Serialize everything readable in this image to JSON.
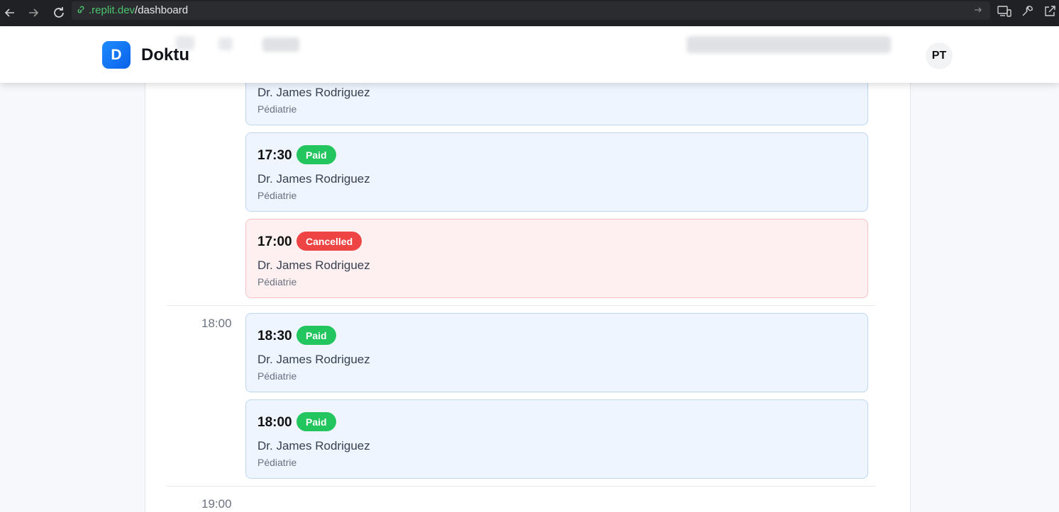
{
  "browser": {
    "url_host": ".replit.dev",
    "url_path": "/dashboard"
  },
  "header": {
    "logo_letter": "D",
    "brand": "Doktu",
    "avatar_initials": "PT"
  },
  "schedule": {
    "top_appointment": {
      "doctor": "Dr. James Rodriguez",
      "specialty": "Pédiatrie"
    },
    "hour_18": "18:00",
    "hour_19": "19:00",
    "appointments": [
      {
        "time": "17:30",
        "status": "Paid",
        "doctor": "Dr. James Rodriguez",
        "specialty": "Pédiatrie"
      },
      {
        "time": "17:00",
        "status": "Cancelled",
        "doctor": "Dr. James Rodriguez",
        "specialty": "Pédiatrie"
      },
      {
        "time": "18:30",
        "status": "Paid",
        "doctor": "Dr. James Rodriguez",
        "specialty": "Pédiatrie"
      },
      {
        "time": "18:00",
        "status": "Paid",
        "doctor": "Dr. James Rodriguez",
        "specialty": "Pédiatrie"
      }
    ]
  },
  "colors": {
    "paid": "#22c55e",
    "cancelled": "#ef4444",
    "brand": "#0a62e8"
  }
}
